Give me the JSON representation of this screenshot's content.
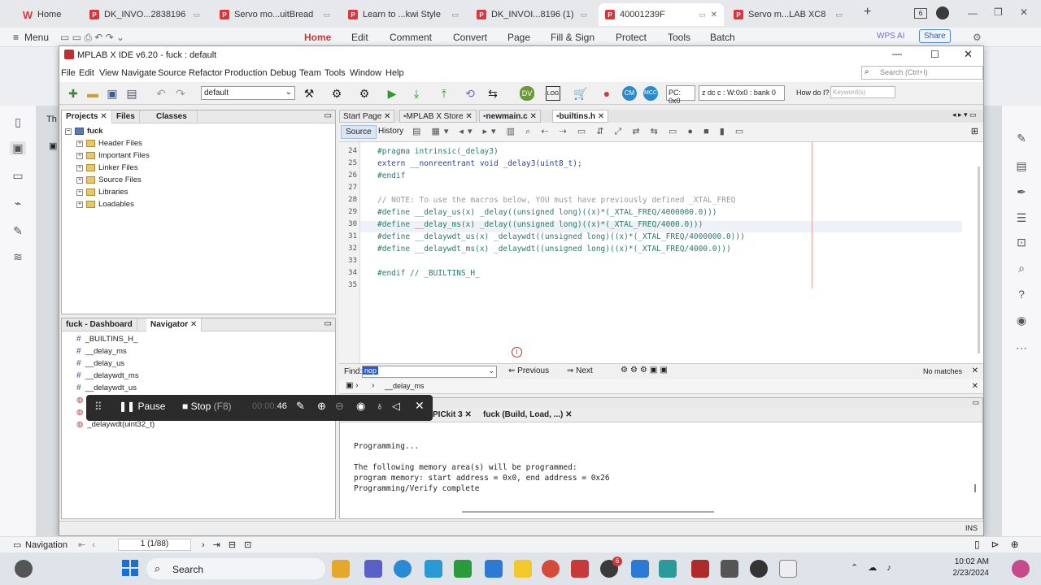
{
  "browser_tabs": [
    {
      "label": "Home",
      "icon": "wps-icon",
      "active": false
    },
    {
      "label": "DK_INVO...2838196",
      "icon": "pdf-icon",
      "active": false
    },
    {
      "label": "Servo mo...uitBread",
      "icon": "pdf-icon",
      "active": false
    },
    {
      "label": "Learn to ...kwi Style",
      "icon": "pdf-icon",
      "active": false
    },
    {
      "label": "DK_INVOI...8196 (1)",
      "icon": "pdf-icon",
      "active": false
    },
    {
      "label": "40001239F",
      "icon": "pdf-icon",
      "active": true
    },
    {
      "label": "Servo m...LAB XC8",
      "icon": "pdf-icon",
      "active": false
    }
  ],
  "pdf_toolbar": {
    "menu": "Menu",
    "items": [
      "Home",
      "Edit",
      "Comment",
      "Convert",
      "Page",
      "Fill & Sign",
      "Protect",
      "Tools",
      "Batch"
    ],
    "wps_ai": "WPS AI",
    "share": "Share",
    "tab_count": "6"
  },
  "ide": {
    "title": "MPLAB X IDE v6.20 - fuck : default",
    "menus": [
      "File",
      "Edit",
      "View",
      "Navigate",
      "Source",
      "Refactor",
      "Production",
      "Debug",
      "Team",
      "Tools",
      "Window",
      "Help"
    ],
    "search_placeholder": "Search (Ctrl+I)",
    "config": "default",
    "pc": "PC: 0x0",
    "status_reg": "z dc c  : W:0x0 : bank 0",
    "how_do_i": "How do I?",
    "keyword_placeholder": "Keyword(s)"
  },
  "projects_panel": {
    "tabs": [
      "Projects",
      "Files",
      "Classes"
    ],
    "root": "fuck",
    "items": [
      "Header Files",
      "Important Files",
      "Linker Files",
      "Source Files",
      "Libraries",
      "Loadables"
    ]
  },
  "navigator_panel": {
    "tabs": [
      "fuck - Dashboard",
      "Navigator"
    ],
    "items": [
      "_BUILTINS_H_",
      "__delay_ms",
      "__delay_us",
      "__delaywdt_ms",
      "__delaywdt_us"
    ],
    "partial_item": "_delaywdt(uint32_t)"
  },
  "editor": {
    "tabs": [
      "Start Page",
      "MPLAB X Store",
      "newmain.c",
      "builtins.h"
    ],
    "source_tab": "Source",
    "history_tab": "History",
    "lines": [
      {
        "n": "24",
        "text": "#pragma intrinsic(_delay3)"
      },
      {
        "n": "25",
        "text": "extern __nonreentrant void _delay3(uint8_t);"
      },
      {
        "n": "26",
        "text": "#endif"
      },
      {
        "n": "27",
        "text": ""
      },
      {
        "n": "28",
        "text": "// NOTE: To use the macros below, YOU must have previously defined _XTAL_FREQ"
      },
      {
        "n": "29",
        "text": "#define __delay_us(x) _delay((unsigned long)((x)*(_XTAL_FREQ/4000000.0)))"
      },
      {
        "n": "30",
        "text": "#define __delay_ms(x) _delay((unsigned long)((x)*(_XTAL_FREQ/4000.0)))"
      },
      {
        "n": "31",
        "text": "#define __delaywdt_us(x) _delaywdt((unsigned long)((x)*(_XTAL_FREQ/4000000.0)))"
      },
      {
        "n": "32",
        "text": "#define __delaywdt_ms(x) _delaywdt((unsigned long)((x)*(_XTAL_FREQ/4000.0)))"
      },
      {
        "n": "33",
        "text": ""
      },
      {
        "n": "34",
        "text": "#endif // _BUILTINS_H_"
      },
      {
        "n": "35",
        "text": ""
      }
    ]
  },
  "find": {
    "label": "Find:",
    "value": "nop",
    "previous": "Previous",
    "next": "Next",
    "result": "No matches"
  },
  "breadcrumb": "__delay_ms",
  "output": {
    "tabs": [
      "PICkit 3",
      "fuck (Build, Load, ...)"
    ],
    "lines": [
      "Programming...",
      "",
      "The following memory area(s) will be programmed:",
      "program memory: start address = 0x0, end address = 0x26",
      "Programming/Verify complete"
    ]
  },
  "status": {
    "ins": "INS"
  },
  "recorder": {
    "pause": "Pause",
    "stop": "Stop",
    "shortcut": "(F8)",
    "time_prefix": "00:00:",
    "time": "46"
  },
  "pdf_nav": {
    "label": "Navigation",
    "page": "1 (1/88)"
  },
  "taskbar": {
    "search": "Search",
    "time": "10:02 AM",
    "date": "2/23/2024",
    "badge": "6"
  }
}
